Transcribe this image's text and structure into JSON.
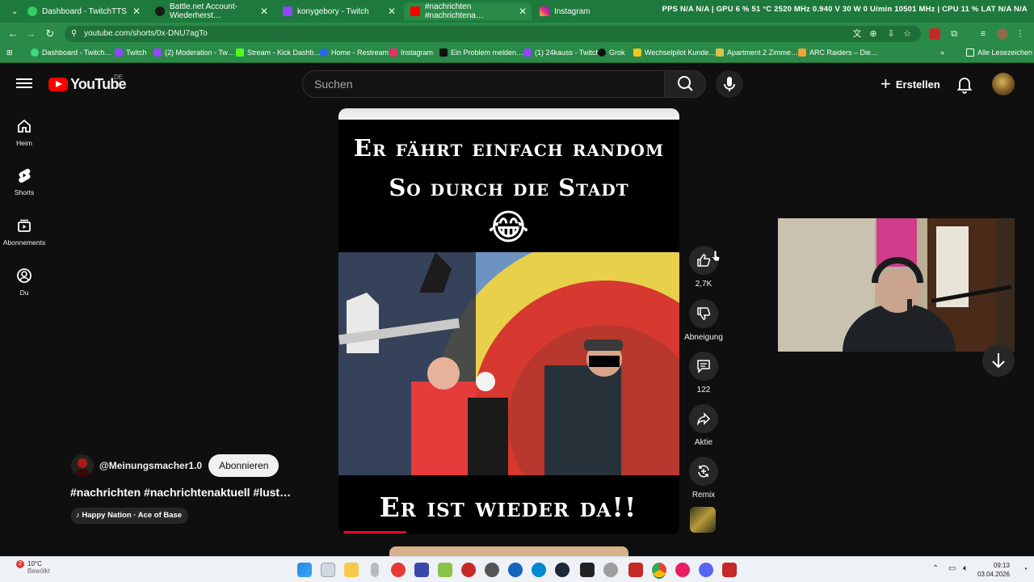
{
  "browser": {
    "tabs": [
      {
        "label": "Dashboard - TwitchTTS",
        "color": "#9146ff"
      },
      {
        "label": "Battle.net Account-Wiederherst…",
        "color": "#222222"
      },
      {
        "label": "konygebory - Twitch",
        "color": "#9146ff"
      },
      {
        "label": "#nachrichten #nachrichtena…",
        "color": "#ff0000"
      },
      {
        "label": "Instagram",
        "color": "#e1306c"
      }
    ],
    "hud": "PPS  N/A  N/A  | GPU  6 %  51 °C  2520 MHz  0.940 V  30 W  0 U/min  10501 MHz  | CPU  11 %  LAT  N/A  N/A",
    "url": "youtube.com/shorts/0x-DNU7agTo",
    "bookmarks": [
      "Dashboard - Twitch…",
      "Twitch",
      "(2) Moderation - Tw…",
      "Stream - Kick Dashb…",
      "Home - Restream",
      "Instagram",
      "Ein Problem melden…",
      "(1) 24kauss - Twitch",
      "Grok",
      "Wechselpilot Kunde…",
      "Apartment 2 Zimme…",
      "ARC Raiders – Die…"
    ],
    "all_bookmarks": "Alle Lesezeichen"
  },
  "yt": {
    "logo_text": "YouTube",
    "country": "DE",
    "search_placeholder": "Suchen",
    "create_label": "Erstellen",
    "sidebar": [
      {
        "label": "Heim",
        "icon": "home-icon"
      },
      {
        "label": "Shorts",
        "icon": "shorts-icon"
      },
      {
        "label": "Abonnements",
        "icon": "subscriptions-icon"
      },
      {
        "label": "Du",
        "icon": "you-icon"
      }
    ],
    "video": {
      "caption_top_1": "Er fährt einfach random",
      "caption_top_2": "So durch die Stadt",
      "emoji": "😂",
      "caption_bottom": "Er ist wieder da!!",
      "progress_fraction": 0.19
    },
    "actions": {
      "like_count": "2,7K",
      "dislike_label": "Abneigung",
      "comment_count": "122",
      "share_label": "Aktie",
      "remix_label": "Remix"
    },
    "channel": {
      "name": "@Meinungsmacher1.0",
      "subscribe_label": "Abonnieren",
      "hashtags": "#nachrichten  #nachrichtenaktuell  #lust…",
      "music": "Happy Nation · Ace of Base"
    }
  },
  "taskbar": {
    "weather_temp": "10°C",
    "weather_desc": "Bewölkt",
    "notification_count": "2",
    "time": "09:13",
    "date": "03.04.2026"
  }
}
